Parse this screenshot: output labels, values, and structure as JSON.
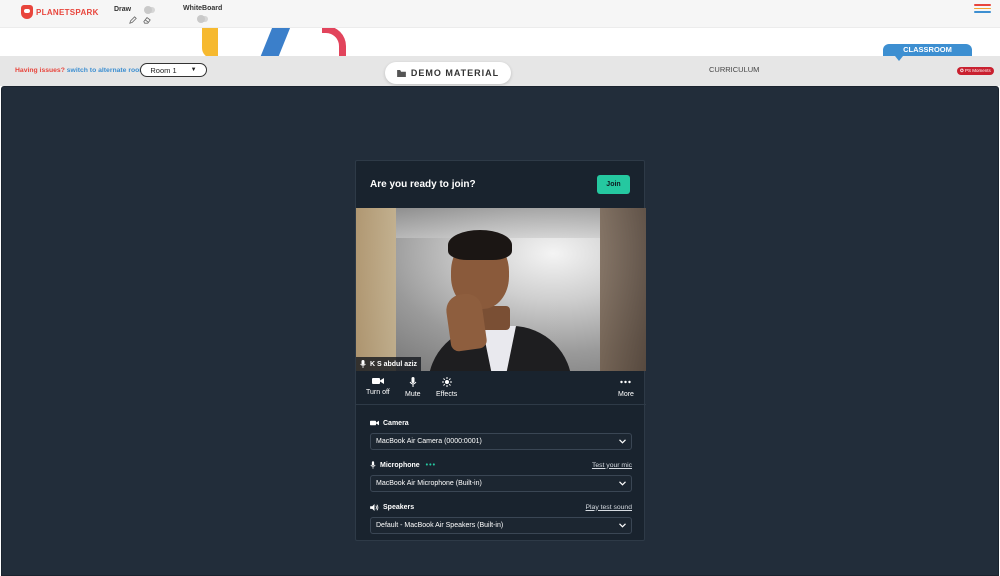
{
  "header": {
    "logo_text": "PLANETSPARK",
    "draw_label": "Draw",
    "whiteboard_label": "WhiteBoard"
  },
  "classroom_tab": "CLASSROOM",
  "nav": {
    "issues_question": "Having issues?",
    "issues_link": "switch to alternate room",
    "room_value": "Room 1",
    "demo_material": "DEMO MATERIAL",
    "curriculum": "CURRICULUM",
    "ps_moments": "PS Moments"
  },
  "modal": {
    "title": "Are you ready to join?",
    "join_label": "Join",
    "participant_name": "K S abdul aziz",
    "controls": {
      "turn_off": "Turn off",
      "mute": "Mute",
      "effects": "Effects",
      "more": "More"
    },
    "camera": {
      "label": "Camera",
      "value": "MacBook Air Camera (0000:0001)"
    },
    "microphone": {
      "label": "Microphone",
      "link": "Test your mic",
      "value": "MacBook Air Microphone (Built-in)"
    },
    "speakers": {
      "label": "Speakers",
      "link": "Play test sound",
      "value": "Default - MacBook Air Speakers (Built-in)"
    }
  },
  "colors": {
    "brand_red": "#e8453c",
    "brand_blue": "#3d8fd1",
    "join_green": "#25c8a0",
    "main_bg": "#222d3a"
  }
}
